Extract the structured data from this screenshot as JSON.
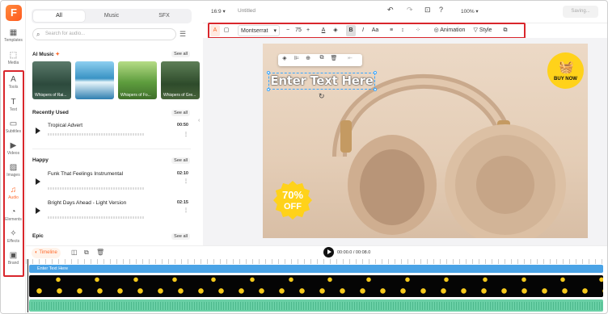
{
  "app": {
    "logo": "F"
  },
  "rail": [
    {
      "label": "Templates",
      "icon": "templates-icon",
      "glyph": "▦"
    },
    {
      "label": "Media",
      "icon": "media-icon",
      "glyph": "⬚"
    },
    {
      "label": "Tools",
      "icon": "tools-icon",
      "glyph": "A"
    },
    {
      "label": "Text",
      "icon": "text-icon",
      "glyph": "T"
    },
    {
      "label": "Subtitles",
      "icon": "subtitles-icon",
      "glyph": "▭"
    },
    {
      "label": "Videos",
      "icon": "videos-icon",
      "glyph": "▶"
    },
    {
      "label": "Images",
      "icon": "images-icon",
      "glyph": "▨"
    },
    {
      "label": "Audio",
      "icon": "audio-icon",
      "glyph": "♫"
    },
    {
      "label": "Elements",
      "icon": "elements-icon",
      "glyph": "◔"
    },
    {
      "label": "Effects",
      "icon": "effects-icon",
      "glyph": "✧"
    },
    {
      "label": "Brand",
      "icon": "brand-icon",
      "glyph": "▣"
    }
  ],
  "panel": {
    "tabs": [
      "All",
      "Music",
      "SFX"
    ],
    "search_placeholder": "Search for audio...",
    "ai_music_title": "AI Music",
    "see_all": "See all",
    "ai_thumbs": [
      "Whispers of Rai...",
      "",
      "Whispers of Fo...",
      "Whispers of Gre..."
    ],
    "recently_used_title": "Recently Used",
    "recent_tracks": [
      {
        "title": "Tropical Advert",
        "duration": "00:50"
      }
    ],
    "happy_title": "Happy",
    "happy_tracks": [
      {
        "title": "Funk That Feelings Instrumental",
        "duration": "02:10"
      },
      {
        "title": "Bright Days Ahead - Light Version",
        "duration": "02:15"
      }
    ],
    "epic_title": "Epic"
  },
  "topbar": {
    "ratio": "16:9",
    "title": "Untitled",
    "zoom": "100%",
    "saving": "Saving..."
  },
  "toolbar": {
    "font": "Montserrat",
    "size": "75",
    "animation": "Animation",
    "style": "Style"
  },
  "canvas": {
    "text": "Enter Text Here",
    "buy_now": "BUY NOW",
    "percent": "70%",
    "off": "OFF"
  },
  "timeline": {
    "button": "Timeline",
    "time": "00:00.0 / 00:08.0",
    "text_track": "Enter Text Here"
  },
  "colors": {
    "accent": "#ff6a2b",
    "highlight": "#d9262c",
    "audio": "#6ad0a6",
    "text_track": "#4aa3e6",
    "badge": "#ffd21a"
  }
}
